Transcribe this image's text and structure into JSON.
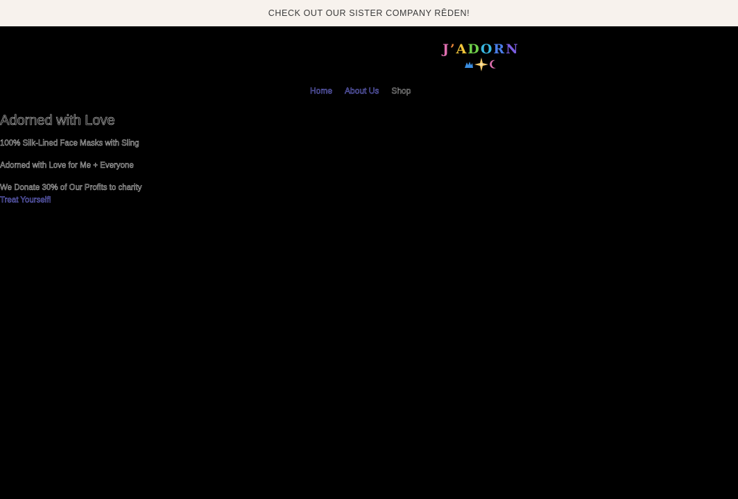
{
  "announcement": {
    "text": "CHECK OUT OUR SISTER COMPANY RĒDEN!"
  },
  "logo": {
    "letters": [
      {
        "char": "J",
        "color": "#e06fb0"
      },
      {
        "char": "’",
        "color": "#f08a3a"
      },
      {
        "char": "A",
        "color": "#f2c53a"
      },
      {
        "char": "D",
        "color": "#6fcf4a"
      },
      {
        "char": "O",
        "color": "#39b7e0"
      },
      {
        "char": "R",
        "color": "#4a7de8"
      },
      {
        "char": "N",
        "color": "#7a5de0"
      }
    ],
    "icons": [
      "hand-icon",
      "star-icon",
      "crescent-icon"
    ]
  },
  "nav": {
    "items": [
      {
        "label": "Home"
      },
      {
        "label": "About Us"
      },
      {
        "label": "Shop"
      }
    ]
  },
  "hero": {
    "title": "Adorned with Love",
    "lines": [
      "100% Silk-Lined Face Masks with Sling",
      "Adorned with Love for Me + Everyone",
      "We Donate 30% of Our Profits to charity"
    ],
    "cta": "Treat Yourself!"
  },
  "colors": {
    "background": "#000000",
    "announcement_bg": "#f7f2ed",
    "link": "#7c7cf2",
    "text": "#c8c8c8"
  }
}
